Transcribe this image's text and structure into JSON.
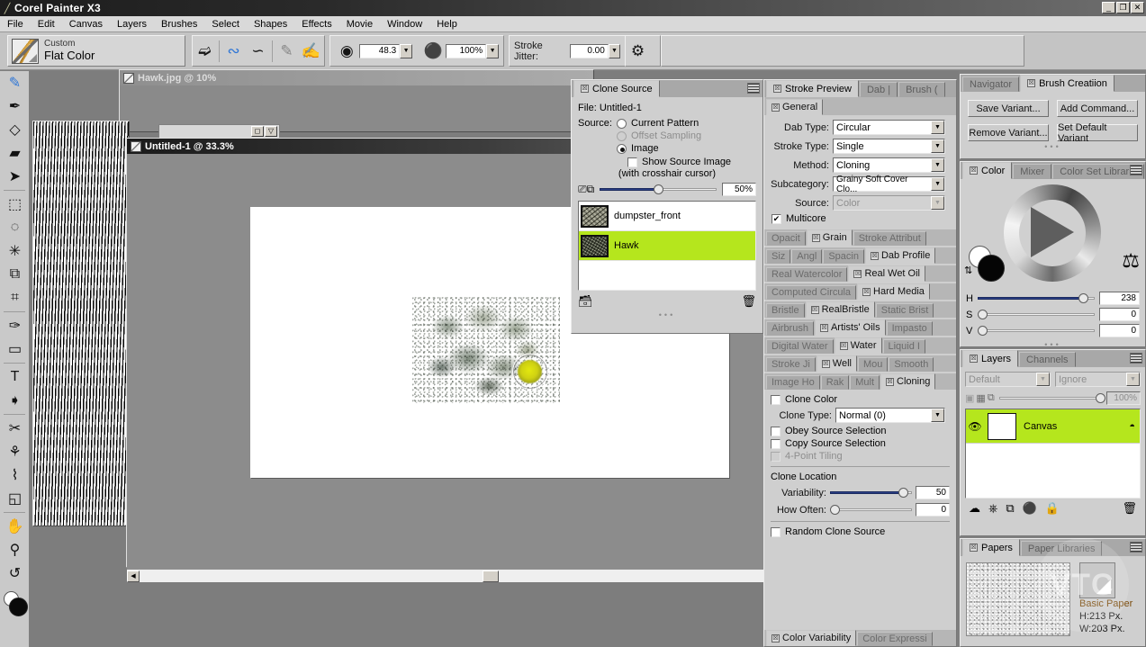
{
  "window": {
    "title": "Corel Painter X3",
    "app_icon": "painter-logo-icon",
    "minimize": "_",
    "restore": "❐",
    "close": "✕"
  },
  "menubar": {
    "items": [
      "File",
      "Edit",
      "Canvas",
      "Layers",
      "Brushes",
      "Select",
      "Shapes",
      "Effects",
      "Movie",
      "Window",
      "Help"
    ]
  },
  "propertybar": {
    "brush_category": "Custom",
    "brush_variant": "Flat Color",
    "icons": [
      "freehand-stroke-icon",
      "straight-line-stroke-icon",
      "curve-stroke-icon",
      "loaded-brush-icon",
      "dry-brush-icon",
      "size-icon",
      "opacity-icon",
      "brush-settings-icon"
    ],
    "size_value": "48.3",
    "opacity_value": "100%",
    "stroke_jitter_label": "Stroke Jitter:",
    "stroke_jitter_value": "0.00"
  },
  "toolbox": {
    "tools": [
      {
        "name": "brush-tool",
        "glyph": "✎",
        "selected": true
      },
      {
        "name": "dropper-tool",
        "glyph": "✒"
      },
      {
        "name": "paint-bucket-tool",
        "glyph": "◇"
      },
      {
        "name": "eraser-tool",
        "glyph": "▰"
      },
      {
        "name": "layer-adjuster-tool",
        "glyph": "➤"
      },
      {
        "name": "rectangular-selection-tool",
        "glyph": "⬚"
      },
      {
        "name": "lasso-tool",
        "glyph": "◌"
      },
      {
        "name": "magic-wand-tool",
        "glyph": "✳"
      },
      {
        "name": "selection-adjuster-tool",
        "glyph": "⧉"
      },
      {
        "name": "crop-tool",
        "glyph": "⌗"
      },
      {
        "name": "pen-tool",
        "glyph": "✑"
      },
      {
        "name": "rectangular-shape-tool",
        "glyph": "▭"
      },
      {
        "name": "text-tool",
        "glyph": "T"
      },
      {
        "name": "shape-selection-tool",
        "glyph": "➧"
      },
      {
        "name": "scissors-tool",
        "glyph": "✂"
      },
      {
        "name": "mirror-painting-tool",
        "glyph": "⚘"
      },
      {
        "name": "divine-proportion-tool",
        "glyph": "⌇"
      },
      {
        "name": "perspective-grid-tool",
        "glyph": "◱"
      },
      {
        "name": "grabber-hand-tool",
        "glyph": "✋"
      },
      {
        "name": "magnifier-tool",
        "glyph": "⚲"
      },
      {
        "name": "rotate-page-tool",
        "glyph": "↺"
      }
    ],
    "color_swatches": "main-and-additional-color-swatches"
  },
  "documents": [
    {
      "name": "hawk-document",
      "title": "Hawk.jpg @ 10%",
      "active": false
    },
    {
      "name": "untitled-document",
      "title": "Untitled-1 @ 33.3%",
      "active": true
    }
  ],
  "clone_source": {
    "tab_label": "Clone Source",
    "file_label": "File: Untitled-1",
    "source_label": "Source:",
    "options": [
      {
        "label": "Current Pattern",
        "selected": false,
        "disabled": false
      },
      {
        "label": "Offset Sampling",
        "selected": false,
        "disabled": true
      },
      {
        "label": "Image",
        "selected": true,
        "disabled": false
      }
    ],
    "show_source_image": "Show Source Image",
    "show_source_checked": false,
    "crosshair_note": "(with crosshair cursor)",
    "opacity_value": "50%",
    "opacity_percent": 50,
    "items": [
      {
        "label": "dumpster_front",
        "selected": false
      },
      {
        "label": "Hawk",
        "selected": true
      }
    ],
    "open_source_icon": "open-source-icon",
    "delete_icon": "trash-icon"
  },
  "brush_controls": {
    "top_tabs": [
      {
        "label": "Stroke Preview",
        "active": true
      },
      {
        "label": "Dab |",
        "active": false
      },
      {
        "label": "Brush (",
        "active": false
      }
    ],
    "general": {
      "tab_label": "General",
      "fields": [
        {
          "label": "Dab Type:",
          "value": "Circular",
          "disabled": false
        },
        {
          "label": "Stroke Type:",
          "value": "Single",
          "disabled": false
        },
        {
          "label": "Method:",
          "value": "Cloning",
          "disabled": false
        },
        {
          "label": "Subcategory:",
          "value": "Grainy Soft Cover Clo...",
          "disabled": false
        },
        {
          "label": "Source:",
          "value": "Color",
          "disabled": true
        }
      ],
      "multicore_label": "Multicore",
      "multicore_checked": true
    },
    "section_rows": [
      [
        {
          "label": "Opacit",
          "on": false
        },
        {
          "label": "Grain",
          "on": true
        },
        {
          "label": "Stroke Attribut",
          "on": false
        }
      ],
      [
        {
          "label": "Siz",
          "on": false
        },
        {
          "label": "Angl",
          "on": false
        },
        {
          "label": "Spacin",
          "on": false
        },
        {
          "label": "Dab Profile",
          "on": true
        }
      ],
      [
        {
          "label": "Real Watercolor",
          "on": false
        },
        {
          "label": "Real Wet Oil",
          "on": true
        }
      ],
      [
        {
          "label": "Computed Circula",
          "on": false
        },
        {
          "label": "Hard Media",
          "on": true
        }
      ],
      [
        {
          "label": "Bristle",
          "on": false
        },
        {
          "label": "RealBristle",
          "on": true
        },
        {
          "label": "Static Brist",
          "on": false
        }
      ],
      [
        {
          "label": "Airbrush",
          "on": false
        },
        {
          "label": "Artists' Oils",
          "on": true
        },
        {
          "label": "Impasto",
          "on": false
        }
      ],
      [
        {
          "label": "Digital Water",
          "on": false
        },
        {
          "label": "Water",
          "on": true
        },
        {
          "label": "Liquid I",
          "on": false
        }
      ],
      [
        {
          "label": "Stroke Ji",
          "on": false
        },
        {
          "label": "Well",
          "on": true
        },
        {
          "label": "Mou",
          "on": false
        },
        {
          "label": "Smooth",
          "on": false
        }
      ],
      [
        {
          "label": "Image Ho",
          "on": false
        },
        {
          "label": "Rak",
          "on": false
        },
        {
          "label": "Mult",
          "on": false
        },
        {
          "label": "Cloning",
          "on": true
        }
      ]
    ],
    "cloning": {
      "clone_color_label": "Clone Color",
      "clone_color_checked": false,
      "clone_type_label": "Clone Type:",
      "clone_type_value": "Normal (0)",
      "obey_source_selection": "Obey Source Selection",
      "obey_checked": false,
      "copy_source_selection": "Copy Source Selection",
      "copy_checked": false,
      "four_point_tiling": "4-Point Tiling",
      "four_point_disabled": true,
      "clone_location_label": "Clone Location",
      "variability_label": "Variability:",
      "variability_value": "50",
      "variability_percent": 88,
      "how_often_label": "How Often:",
      "how_often_value": "0",
      "how_often_percent": 0,
      "random_clone_source": "Random Clone Source",
      "random_checked": false
    },
    "bottom_tabs": [
      {
        "label": "Color Variability",
        "active": true
      },
      {
        "label": "Color Expressi",
        "active": false
      }
    ]
  },
  "right_panels": {
    "brush_creation": {
      "tabs": [
        {
          "label": "Navigator",
          "active": false
        },
        {
          "label": "Brush Creatiion",
          "active": true
        }
      ],
      "buttons": [
        "Save Variant...",
        "Add Command...",
        "Remove Variant...",
        "Set Default Variant"
      ]
    },
    "color": {
      "tabs": [
        {
          "label": "Color",
          "active": true
        },
        {
          "label": "Mixer",
          "active": false
        },
        {
          "label": "Color Set Librarie",
          "active": false
        }
      ],
      "clone_color_stamp_icon": "clone-color-stamp-icon",
      "sliders": [
        {
          "label": "H",
          "value": "238",
          "percent": 90
        },
        {
          "label": "S",
          "value": "0",
          "percent": 0
        },
        {
          "label": "V",
          "value": "0",
          "percent": 0
        }
      ]
    },
    "layers": {
      "tabs": [
        {
          "label": "Layers",
          "active": true
        },
        {
          "label": "Channels",
          "active": false
        }
      ],
      "composite_method": "Default",
      "composite_depth": "Ignore",
      "opacity": "100%",
      "opacity_percent": 100,
      "rows": [
        {
          "name": "Canvas",
          "selected": true,
          "visible": true
        }
      ],
      "toolbar_icons": [
        "dynamic-plugins-icon",
        "new-layer-group-icon",
        "new-layer-icon",
        "layer-mask-icon",
        "lock-icon",
        "delete-layer-icon"
      ]
    },
    "papers": {
      "tabs": [
        {
          "label": "Papers",
          "active": true
        },
        {
          "label": "Paper Libraries",
          "active": false
        }
      ],
      "paper_name": "Basic Paper",
      "height": "H:213 Px.",
      "width": "W:203 Px."
    }
  },
  "watermark": "VTC"
}
